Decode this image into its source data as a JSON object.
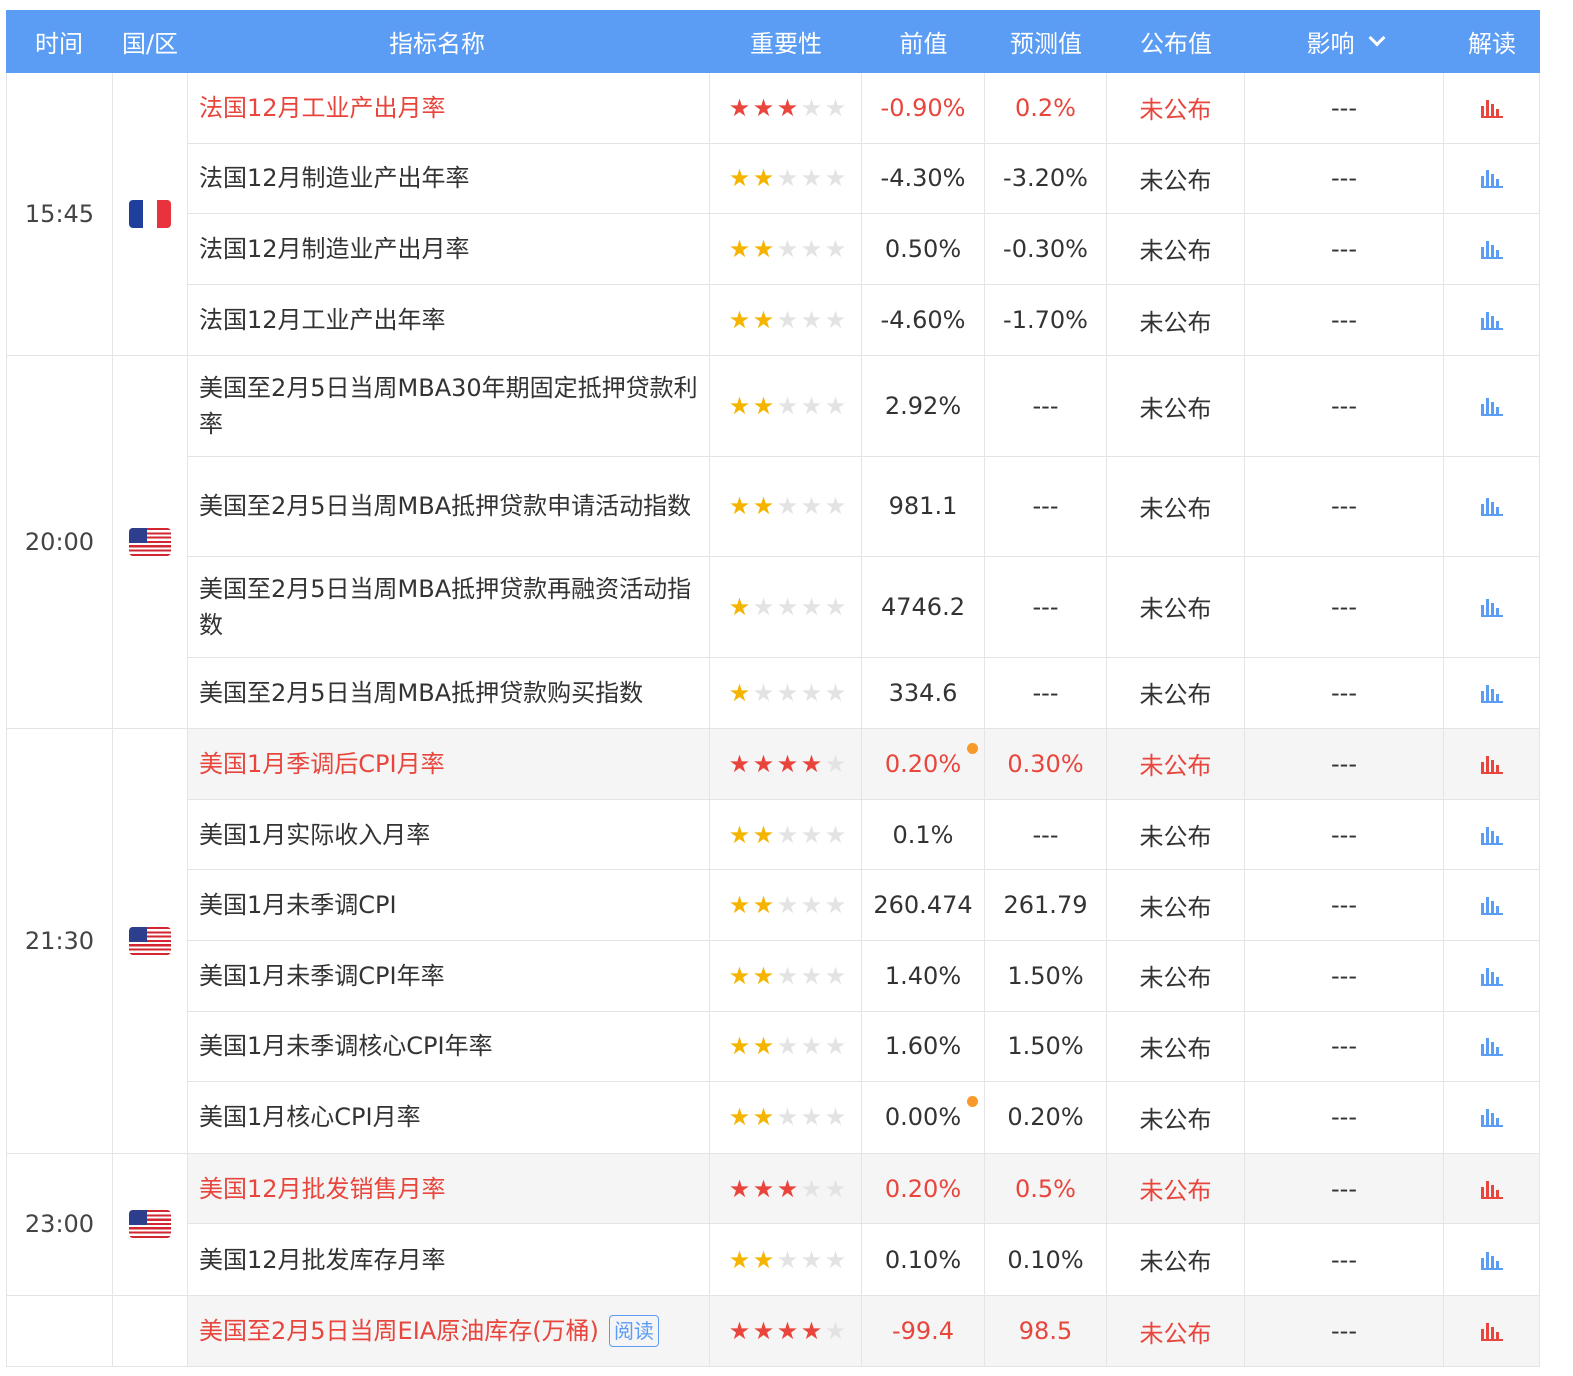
{
  "header": {
    "time": "时间",
    "region": "国/区",
    "name": "指标名称",
    "importance": "重要性",
    "previous": "前值",
    "forecast": "预测值",
    "published": "公布值",
    "impact": "影响",
    "interpret": "解读"
  },
  "colors": {
    "header_bg": "#5b9cf5",
    "red": "#e8453c",
    "star_yellow": "#f5b400",
    "dot_orange": "#f79a2a"
  },
  "groups": [
    {
      "time": "15:45",
      "flag": "france-flag",
      "rows": [
        {
          "name": "法国12月工业产出月率",
          "stars": 3,
          "prev": "-0.90%",
          "fc": "0.2%",
          "pub": "未公布",
          "impact": "---",
          "red": true,
          "hl": false,
          "dot": false
        },
        {
          "name": "法国12月制造业产出年率",
          "stars": 2,
          "prev": "-4.30%",
          "fc": "-3.20%",
          "pub": "未公布",
          "impact": "---",
          "red": false,
          "hl": false,
          "dot": false
        },
        {
          "name": "法国12月制造业产出月率",
          "stars": 2,
          "prev": "0.50%",
          "fc": "-0.30%",
          "pub": "未公布",
          "impact": "---",
          "red": false,
          "hl": false,
          "dot": false
        },
        {
          "name": "法国12月工业产出年率",
          "stars": 2,
          "prev": "-4.60%",
          "fc": "-1.70%",
          "pub": "未公布",
          "impact": "---",
          "red": false,
          "hl": false,
          "dot": false
        }
      ]
    },
    {
      "time": "20:00",
      "flag": "us-flag",
      "rows": [
        {
          "name": "美国至2月5日当周MBA30年期固定抵押贷款利率",
          "stars": 2,
          "prev": "2.92%",
          "fc": "---",
          "pub": "未公布",
          "impact": "---",
          "red": false,
          "hl": false,
          "dot": false,
          "tall": true
        },
        {
          "name": "美国至2月5日当周MBA抵押贷款申请活动指数",
          "stars": 2,
          "prev": "981.1",
          "fc": "---",
          "pub": "未公布",
          "impact": "---",
          "red": false,
          "hl": false,
          "dot": false,
          "tall": true
        },
        {
          "name": "美国至2月5日当周MBA抵押贷款再融资活动指数",
          "stars": 1,
          "prev": "4746.2",
          "fc": "---",
          "pub": "未公布",
          "impact": "---",
          "red": false,
          "hl": false,
          "dot": false,
          "tall": true
        },
        {
          "name": "美国至2月5日当周MBA抵押贷款购买指数",
          "stars": 1,
          "prev": "334.6",
          "fc": "---",
          "pub": "未公布",
          "impact": "---",
          "red": false,
          "hl": false,
          "dot": false
        }
      ]
    },
    {
      "time": "21:30",
      "flag": "us-flag",
      "rows": [
        {
          "name": "美国1月季调后CPI月率",
          "stars": 4,
          "prev": "0.20%",
          "fc": "0.30%",
          "pub": "未公布",
          "impact": "---",
          "red": true,
          "hl": true,
          "dot": true
        },
        {
          "name": "美国1月实际收入月率",
          "stars": 2,
          "prev": "0.1%",
          "fc": "---",
          "pub": "未公布",
          "impact": "---",
          "red": false,
          "hl": false,
          "dot": false
        },
        {
          "name": "美国1月未季调CPI",
          "stars": 2,
          "prev": "260.474",
          "fc": "261.79",
          "pub": "未公布",
          "impact": "---",
          "red": false,
          "hl": false,
          "dot": false
        },
        {
          "name": "美国1月未季调CPI年率",
          "stars": 2,
          "prev": "1.40%",
          "fc": "1.50%",
          "pub": "未公布",
          "impact": "---",
          "red": false,
          "hl": false,
          "dot": false
        },
        {
          "name": "美国1月未季调核心CPI年率",
          "stars": 2,
          "prev": "1.60%",
          "fc": "1.50%",
          "pub": "未公布",
          "impact": "---",
          "red": false,
          "hl": false,
          "dot": false
        },
        {
          "name": "美国1月核心CPI月率",
          "stars": 2,
          "prev": "0.00%",
          "fc": "0.20%",
          "pub": "未公布",
          "impact": "---",
          "red": false,
          "hl": false,
          "dot": true
        }
      ]
    },
    {
      "time": "23:00",
      "flag": "us-flag",
      "rows": [
        {
          "name": "美国12月批发销售月率",
          "stars": 3,
          "prev": "0.20%",
          "fc": "0.5%",
          "pub": "未公布",
          "impact": "---",
          "red": true,
          "hl": true,
          "dot": false
        },
        {
          "name": "美国12月批发库存月率",
          "stars": 2,
          "prev": "0.10%",
          "fc": "0.10%",
          "pub": "未公布",
          "impact": "---",
          "red": false,
          "hl": false,
          "dot": false
        }
      ]
    },
    {
      "time": "",
      "flag": "",
      "rows": [
        {
          "name": "美国至2月5日当周EIA原油库存(万桶)",
          "tag": "阅读",
          "stars": 4,
          "prev": "-99.4",
          "fc": "98.5",
          "pub": "未公布",
          "impact": "---",
          "red": true,
          "hl": true,
          "dot": false
        }
      ]
    }
  ]
}
